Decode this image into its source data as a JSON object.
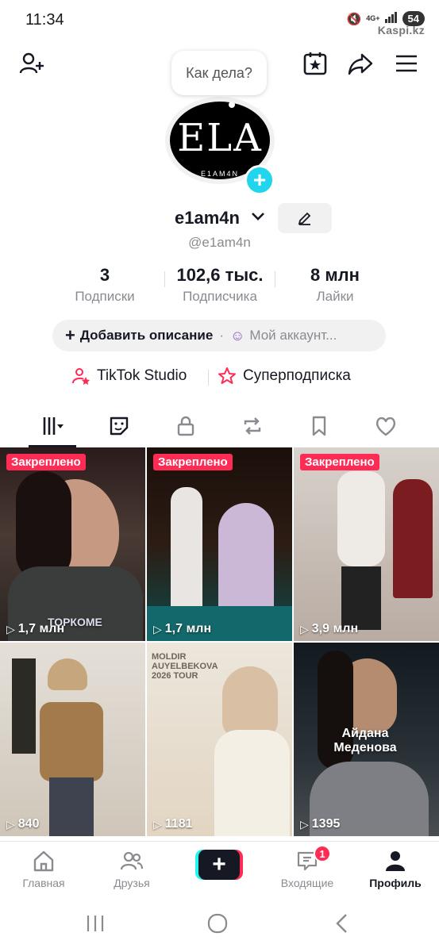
{
  "status_bar": {
    "time": "11:34",
    "network": "4G+",
    "battery": "54",
    "watermark": "Kaspi.kz"
  },
  "header": {
    "add_friend_icon": "person-plus-icon",
    "calendar_icon": "calendar-star-icon",
    "share_icon": "share-arrow-icon",
    "menu_icon": "hamburger-menu-icon"
  },
  "profile": {
    "bubble_text": "Как дела?",
    "avatar_logo": "ELA",
    "avatar_subtext": "E1AM4N",
    "username": "e1am4n",
    "handle": "@e1am4n",
    "stats": [
      {
        "value": "3",
        "label": "Подписки"
      },
      {
        "value": "102,6 тыс.",
        "label": "Подписчика"
      },
      {
        "value": "8 млн",
        "label": "Лайки"
      }
    ],
    "add_description": "Добавить описание",
    "my_account": "Мой аккаунт..."
  },
  "links": {
    "studio": "TikTok Studio",
    "subscription": "Суперподписка"
  },
  "tabs": [
    {
      "icon": "grid-icon",
      "active": true
    },
    {
      "icon": "sticker-icon",
      "active": false
    },
    {
      "icon": "lock-icon",
      "active": false
    },
    {
      "icon": "repost-icon",
      "active": false
    },
    {
      "icon": "bookmark-icon",
      "active": false
    },
    {
      "icon": "heart-icon",
      "active": false
    }
  ],
  "videos": [
    {
      "pinned": "Закреплено",
      "views": "1,7 млн",
      "overlay": "ТОРКОМЕ"
    },
    {
      "pinned": "Закреплено",
      "views": "1,7 млн",
      "overlay": ""
    },
    {
      "pinned": "Закреплено",
      "views": "3,9 млн",
      "overlay": ""
    },
    {
      "pinned": "",
      "views": "840",
      "overlay": ""
    },
    {
      "pinned": "",
      "views": "1181",
      "overlay": "MOLDIR AUYELBEKOVA 2026 TOUR"
    },
    {
      "pinned": "",
      "views": "1395",
      "overlay": "Айдана Меденова"
    }
  ],
  "bottom_nav": {
    "home": "Главная",
    "friends": "Друзья",
    "inbox": "Входящие",
    "inbox_badge": "1",
    "profile": "Профиль"
  },
  "colors": {
    "accent_red": "#fe2c55",
    "accent_cyan": "#25f4ee",
    "avatar_add": "#20d5ec",
    "text": "#161823",
    "muted": "#8a8b91"
  }
}
